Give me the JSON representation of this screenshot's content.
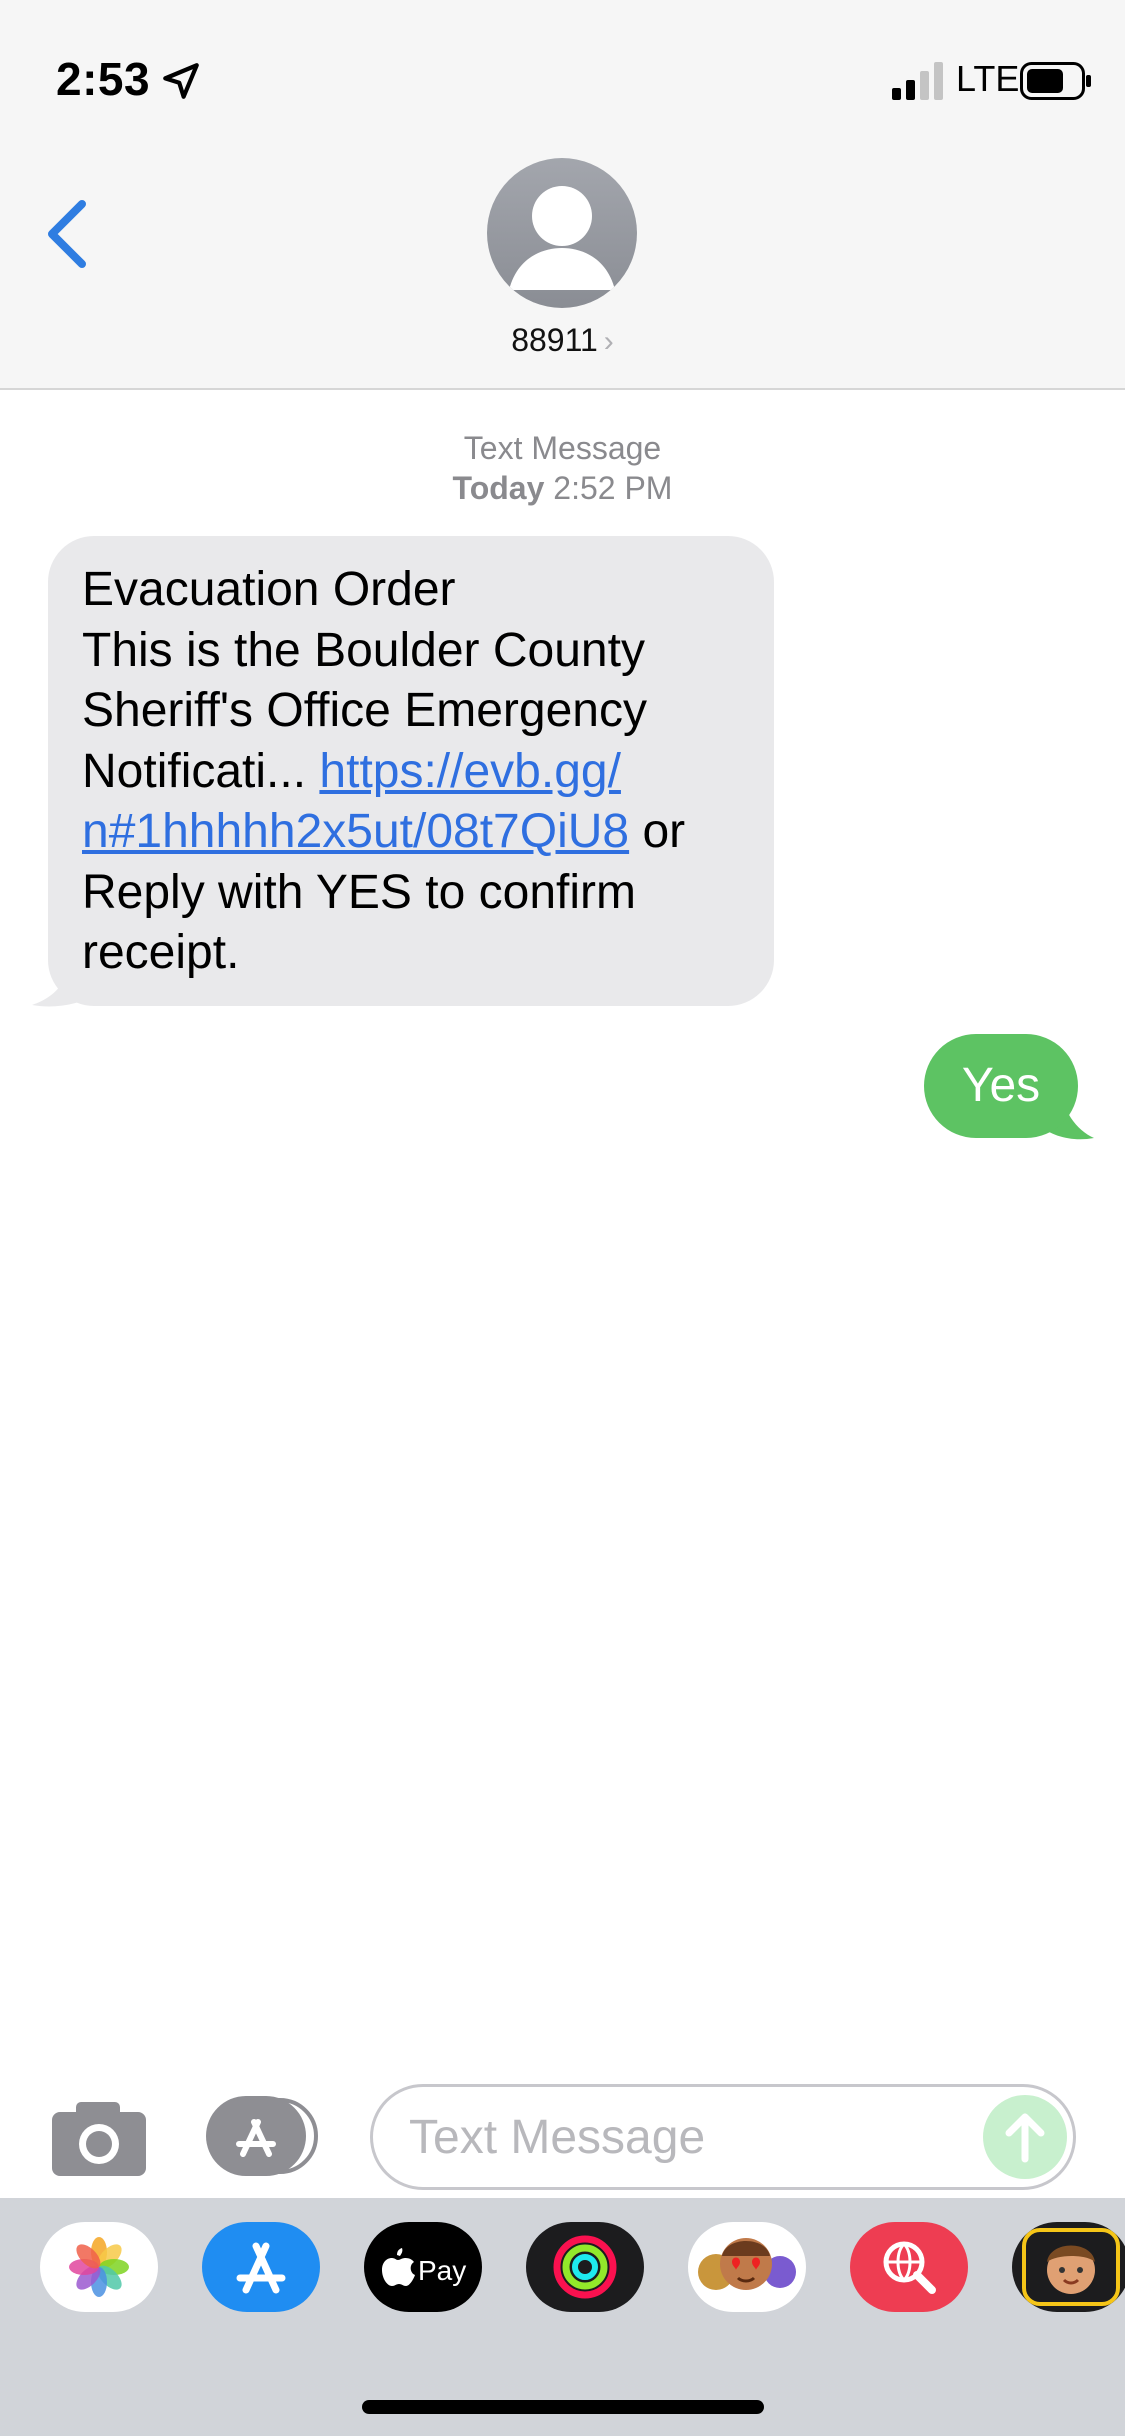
{
  "status_bar": {
    "time": "2:53",
    "network": "LTE"
  },
  "header": {
    "contact": "88911",
    "chevron": "›"
  },
  "conversation": {
    "meta_label": "Text Message",
    "meta_day": "Today",
    "meta_time": "2:52 PM",
    "incoming": {
      "line1": "Evacuation Order",
      "line2": "This is the Boulder County",
      "line3": "Sheriff's Office Emergency",
      "line4_text": "Notificati... ",
      "link_part1": "https://evb.gg/",
      "link_part2": "n#1hhhhh2x5ut/08t7QiU8",
      "after_link": " or",
      "line6": "Reply with YES to confirm",
      "line7": "receipt."
    },
    "outgoing": {
      "text": "Yes"
    }
  },
  "input": {
    "placeholder": "Text Message"
  },
  "app_drawer": {
    "apps": [
      "photos-icon",
      "app-store-icon",
      "apple-pay-icon",
      "activity-icon",
      "memoji-stickers-icon",
      "web-search-icon",
      "memoji-icon"
    ],
    "pay_label": "Pay"
  },
  "colors": {
    "incoming_bubble": "#e9e9eb",
    "outgoing_bubble": "#5dc363",
    "link": "#2f6fe0",
    "accent": "#2f7de1"
  }
}
